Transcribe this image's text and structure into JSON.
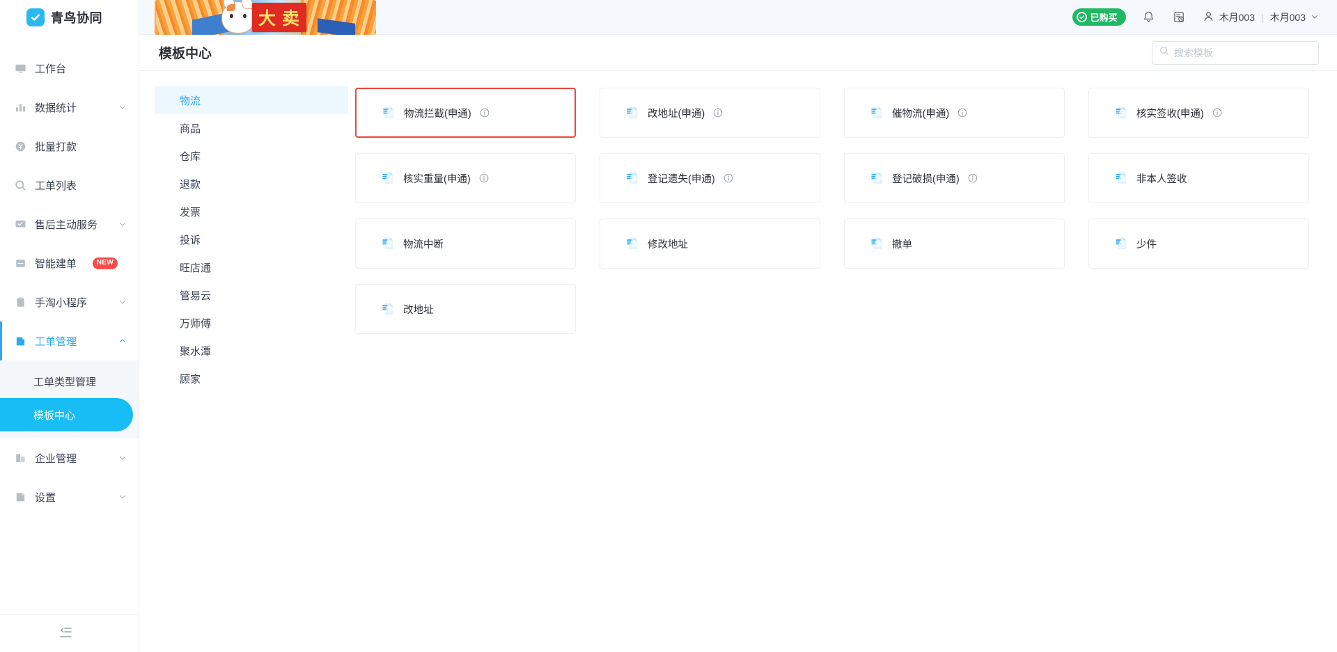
{
  "brand": {
    "name": "青鸟协同",
    "logo_icon": "check-circle-logo"
  },
  "sidebar": {
    "items": [
      {
        "label": "工作台",
        "icon": "monitor-icon",
        "expandable": false,
        "active": false
      },
      {
        "label": "数据统计",
        "icon": "bar-chart-icon",
        "expandable": true,
        "active": false
      },
      {
        "label": "批量打款",
        "icon": "yuan-coin-icon",
        "expandable": false,
        "active": false
      },
      {
        "label": "工单列表",
        "icon": "search-circle-icon",
        "expandable": false,
        "active": false
      },
      {
        "label": "售后主动服务",
        "icon": "message-check-icon",
        "expandable": true,
        "active": false
      },
      {
        "label": "智能建单",
        "icon": "list-icon",
        "expandable": false,
        "active": false,
        "badge": "NEW"
      },
      {
        "label": "手淘小程序",
        "icon": "clipboard-icon",
        "expandable": true,
        "active": false
      },
      {
        "label": "工单管理",
        "icon": "ticket-icon",
        "expandable": true,
        "active": true,
        "expanded": true
      }
    ],
    "sub_items": [
      {
        "label": "工单类型管理",
        "selected": false
      },
      {
        "label": "模板中心",
        "selected": true
      }
    ],
    "items_after": [
      {
        "label": "企业管理",
        "icon": "building-icon",
        "expandable": true,
        "active": false
      },
      {
        "label": "设置",
        "icon": "settings-page-icon",
        "expandable": true,
        "active": false
      }
    ],
    "collapse_icon": "collapse-sidebar-icon",
    "accent_color": "#19bdf5"
  },
  "topbar": {
    "banner_text": "大 卖",
    "purchased_badge": "已购买",
    "purchased_color": "#1fb863",
    "bell_icon": "bell-icon",
    "history_icon": "history-record-icon",
    "user_icon": "user-icon",
    "user_name": "木月003",
    "user_shop": "木月003",
    "separator": "|",
    "chevron_icon": "chevron-down-icon"
  },
  "page": {
    "title": "模板中心",
    "search": {
      "placeholder": "搜索模板",
      "value": "",
      "icon": "search-icon"
    }
  },
  "categories": [
    {
      "label": "物流",
      "selected": true
    },
    {
      "label": "商品",
      "selected": false
    },
    {
      "label": "仓库",
      "selected": false
    },
    {
      "label": "退款",
      "selected": false
    },
    {
      "label": "发票",
      "selected": false
    },
    {
      "label": "投诉",
      "selected": false
    },
    {
      "label": "旺店通",
      "selected": false
    },
    {
      "label": "管易云",
      "selected": false
    },
    {
      "label": "万师傅",
      "selected": false
    },
    {
      "label": "聚水潭",
      "selected": false
    },
    {
      "label": "顾家",
      "selected": false
    }
  ],
  "templates": [
    {
      "label": "物流拦截(申通)",
      "icon": "template-doc-icon",
      "info": true,
      "highlighted": true
    },
    {
      "label": "改地址(申通)",
      "icon": "template-doc-icon",
      "info": true,
      "highlighted": false
    },
    {
      "label": "催物流(申通)",
      "icon": "template-doc-icon",
      "info": true,
      "highlighted": false
    },
    {
      "label": "核实签收(申通)",
      "icon": "template-doc-icon",
      "info": true,
      "highlighted": false
    },
    {
      "label": "核实重量(申通)",
      "icon": "template-doc-icon",
      "info": true,
      "highlighted": false
    },
    {
      "label": "登记遗失(申通)",
      "icon": "template-doc-icon",
      "info": true,
      "highlighted": false
    },
    {
      "label": "登记破损(申通)",
      "icon": "template-doc-icon",
      "info": true,
      "highlighted": false
    },
    {
      "label": "非本人签收",
      "icon": "template-doc-icon",
      "info": false,
      "highlighted": false
    },
    {
      "label": "物流中断",
      "icon": "template-doc-icon",
      "info": false,
      "highlighted": false
    },
    {
      "label": "修改地址",
      "icon": "template-doc-icon",
      "info": false,
      "highlighted": false
    },
    {
      "label": "撤单",
      "icon": "template-doc-icon",
      "info": false,
      "highlighted": false
    },
    {
      "label": "少件",
      "icon": "template-doc-icon",
      "info": false,
      "highlighted": false
    },
    {
      "label": "改地址",
      "icon": "template-doc-icon",
      "info": false,
      "highlighted": false
    }
  ],
  "highlight_color": "#f0453c"
}
